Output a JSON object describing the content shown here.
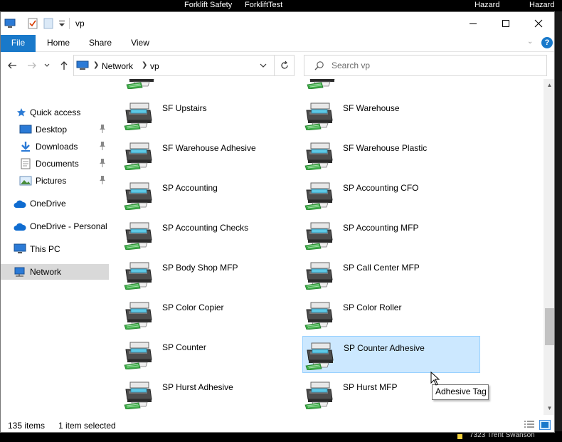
{
  "background": {
    "top_labels": [
      "Forklift Safety",
      "ForkliftTest",
      "Hazard",
      "Hazard"
    ],
    "bottom_text": "7323 Trent Swanson"
  },
  "window": {
    "title": "vp",
    "controls": [
      "minimize-icon",
      "maximize-icon",
      "close-icon"
    ]
  },
  "ribbon": {
    "tabs": [
      "File",
      "Home",
      "Share",
      "View"
    ],
    "help": "?"
  },
  "address": {
    "crumbs": [
      "Network",
      "vp"
    ],
    "search_placeholder": "Search vp"
  },
  "nav": {
    "items": [
      {
        "label": "Quick access",
        "icon": "star-icon"
      },
      {
        "label": "Desktop",
        "icon": "desktop-icon",
        "pinned": true
      },
      {
        "label": "Downloads",
        "icon": "download-arrow-icon",
        "pinned": true
      },
      {
        "label": "Documents",
        "icon": "documents-icon",
        "pinned": true
      },
      {
        "label": "Pictures",
        "icon": "pictures-icon",
        "pinned": true
      },
      {
        "label": "OneDrive",
        "icon": "cloud-icon"
      },
      {
        "label": "OneDrive - Personal",
        "icon": "cloud-icon"
      },
      {
        "label": "This PC",
        "icon": "computer-icon"
      },
      {
        "label": "Network",
        "icon": "network-icon",
        "selected": true
      }
    ]
  },
  "printers": [
    {
      "name": "SF Upstairs"
    },
    {
      "name": "SF Warehouse"
    },
    {
      "name": "SF Warehouse Adhesive"
    },
    {
      "name": "SF Warehouse Plastic"
    },
    {
      "name": "SP Accounting"
    },
    {
      "name": "SP Accounting CFO"
    },
    {
      "name": "SP Accounting Checks"
    },
    {
      "name": "SP Accounting MFP"
    },
    {
      "name": "SP Body Shop MFP"
    },
    {
      "name": "SP Call Center MFP"
    },
    {
      "name": "SP Color Copier"
    },
    {
      "name": "SP Color Roller"
    },
    {
      "name": "SP Counter"
    },
    {
      "name": "SP Counter Adhesive",
      "selected": true
    },
    {
      "name": "SP Hurst Adhesive"
    },
    {
      "name": "SP Hurst MFP"
    }
  ],
  "tooltip": "Adhesive Tag",
  "status": {
    "item_count": "135 items",
    "selection": "1 item selected"
  },
  "colors": {
    "accent": "#1979ca",
    "selection_fill": "#cce8ff",
    "selection_border": "#99d1ff",
    "nav_selected": "#d9d9d9"
  }
}
